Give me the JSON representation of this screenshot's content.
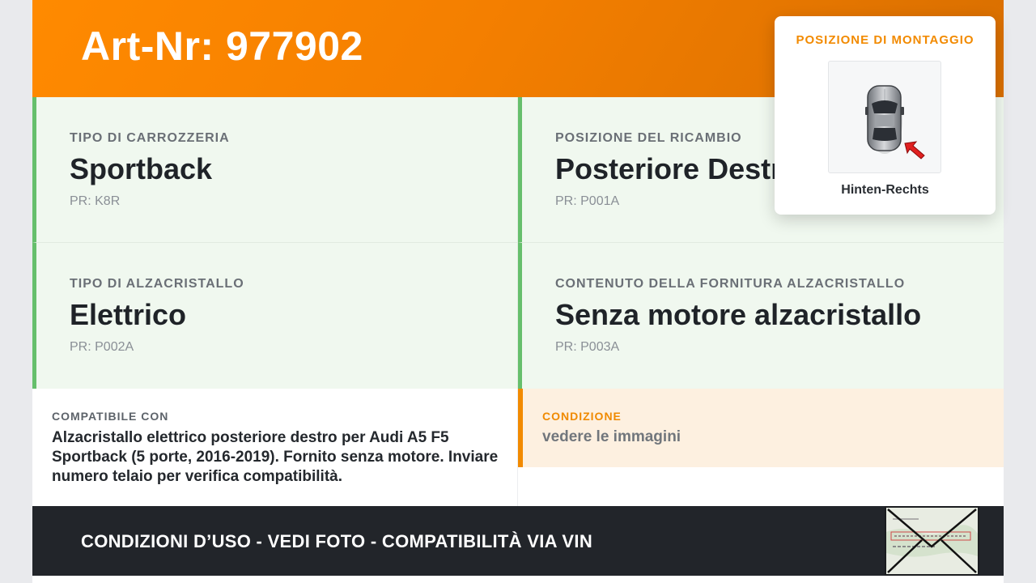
{
  "header": {
    "title": "Art-Nr: 977902"
  },
  "attributes": [
    {
      "label": "TIPO DI CARROZZERIA",
      "value": "Sportback",
      "pr": "PR: K8R"
    },
    {
      "label": "POSIZIONE DEL RICAMBIO",
      "value": "Posteriore Destro",
      "pr": "PR: P001A"
    },
    {
      "label": "TIPO DI ALZACRISTALLO",
      "value": "Elettrico",
      "pr": "PR: P002A"
    },
    {
      "label": "CONTENUTO DELLA FORNITURA ALZACRISTALLO",
      "value": "Senza motore alzacristallo",
      "pr": "PR: P003A"
    }
  ],
  "compatibility": {
    "label": "COMPATIBILE CON",
    "text": "Alzacristallo elettrico posteriore destro per Audi A5 F5 Sportback (5 porte, 2016-2019). Fornito senza motore. Inviare numero telaio per verifica compatibilità."
  },
  "condition": {
    "label": "CONDIZIONE",
    "text": "vedere le immagini"
  },
  "footer": {
    "text": "CONDIZIONI D’USO - VEDI FOTO - COMPATIBILITÀ VIA VIN"
  },
  "mounting": {
    "title": "POSIZIONE DI MONTAGGIO",
    "caption": "Hinten-Rechts"
  },
  "colors": {
    "header_orange": "#f47f00",
    "accent_green": "#66bf6c",
    "accent_orange": "#f28a00",
    "footer_dark": "#22252a"
  },
  "icons": {
    "car": "car-top-view-icon",
    "arrow": "position-arrow-icon",
    "document": "envelope-document-icon"
  }
}
